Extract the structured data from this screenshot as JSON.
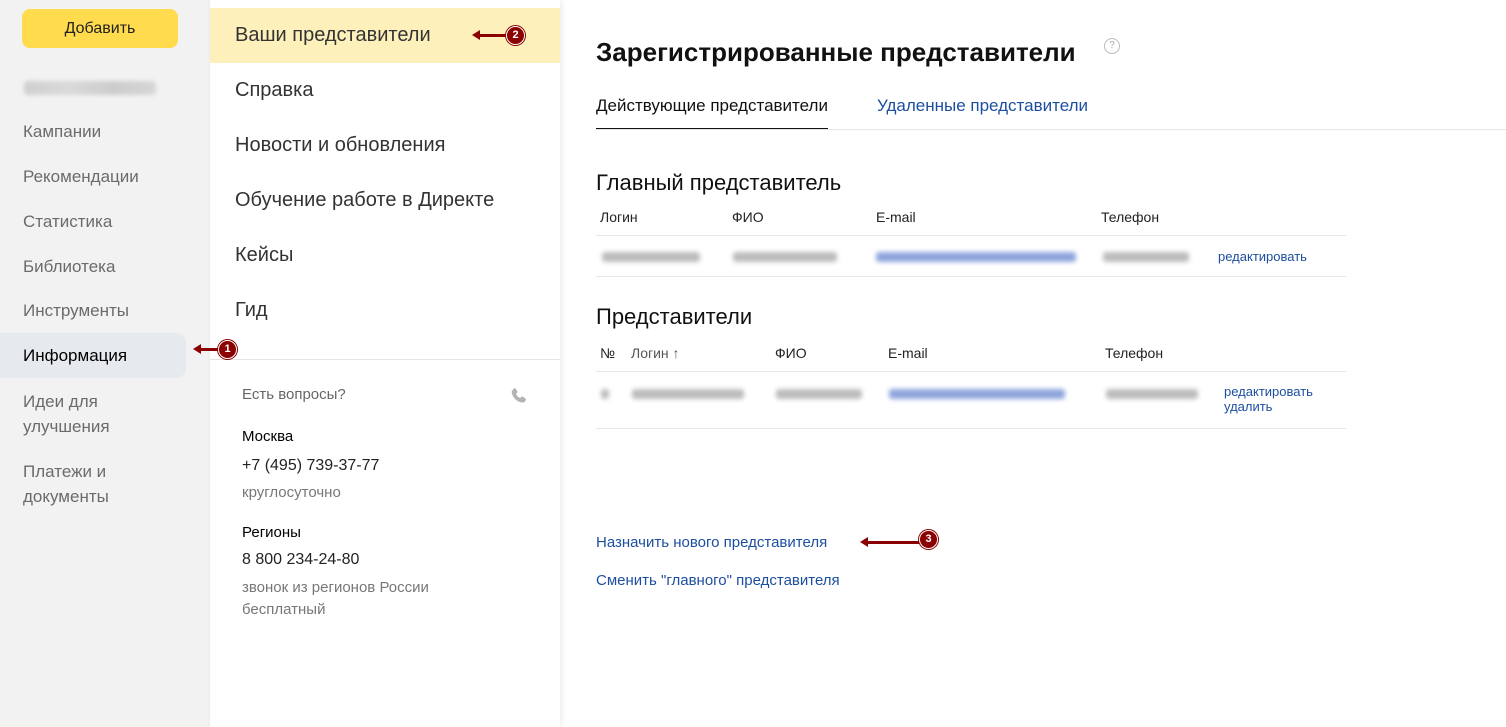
{
  "sidebar": {
    "add_button": "Добавить",
    "items": [
      {
        "label": "Кампании"
      },
      {
        "label": "Рекомендации"
      },
      {
        "label": "Статистика"
      },
      {
        "label": "Библиотека"
      },
      {
        "label": "Инструменты"
      },
      {
        "label": "Информация",
        "active": true
      },
      {
        "label": "Идеи для улучшения"
      },
      {
        "label": "Платежи и документы"
      }
    ]
  },
  "info_menu": {
    "items": [
      {
        "label": "Ваши представители",
        "active": true
      },
      {
        "label": "Справка"
      },
      {
        "label": "Новости и обновления"
      },
      {
        "label": "Обучение работе в Директе"
      },
      {
        "label": "Кейсы"
      },
      {
        "label": "Гид"
      }
    ],
    "contacts": {
      "question": "Есть вопросы?",
      "moscow_city": "Москва",
      "moscow_phone": "+7 (495) 739-37-77",
      "moscow_note": "круглосуточно",
      "regions_city": "Регионы",
      "regions_phone": "8 800 234-24-80",
      "regions_note": "звонок из регионов России бесплатный"
    }
  },
  "main": {
    "title": "Зарегистрированные представители",
    "tabs": [
      {
        "label": "Действующие представители",
        "active": true
      },
      {
        "label": "Удаленные представители",
        "active": false
      }
    ],
    "chief": {
      "title": "Главный представитель",
      "columns": [
        "Логин",
        "ФИО",
        "E-mail",
        "Телефон"
      ],
      "edit_link": "редактировать"
    },
    "reps": {
      "title": "Представители",
      "columns": [
        "№",
        "Логин ↑",
        "ФИО",
        "E-mail",
        "Телефон"
      ],
      "edit_link": "редактировать",
      "delete_link": "удалить"
    },
    "assign_new_link": "Назначить нового представителя",
    "change_chief_link": "Сменить \"главного\" представителя"
  },
  "annotations": [
    "1",
    "2",
    "3"
  ],
  "colors": {
    "add_button": "#ffdb4d",
    "active_menu": "#fef0ba",
    "link": "#1d4fa0",
    "marker": "#8b0000"
  }
}
